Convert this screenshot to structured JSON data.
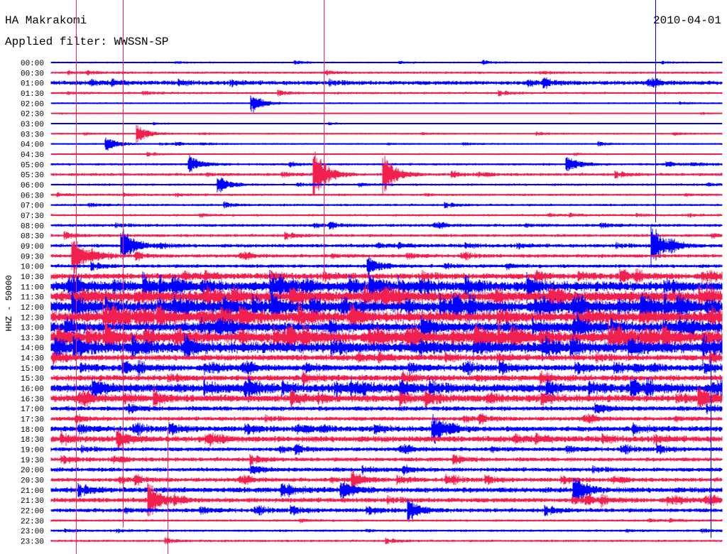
{
  "header": {
    "station": "HA Makrakomi",
    "filter": "Applied filter: WWSSN-SP",
    "date": "2010-04-01"
  },
  "chart_data": {
    "type": "line",
    "title": "HA Makrakomi",
    "subtitle": "Applied filter: WWSSN-SP",
    "ylabel": "HHZ - 50000",
    "xlabel": "",
    "minutes_per_line": 30,
    "colors": {
      "even": "#0000ff",
      "odd": "#f0204f"
    },
    "rows": [
      "00:00",
      "00:30",
      "01:00",
      "01:30",
      "02:00",
      "02:30",
      "03:00",
      "03:30",
      "04:00",
      "04:30",
      "05:00",
      "05:30",
      "06:00",
      "06:30",
      "07:00",
      "07:30",
      "08:00",
      "08:30",
      "09:00",
      "09:30",
      "10:00",
      "10:30",
      "11:00",
      "11:30",
      "12:00",
      "12:30",
      "13:00",
      "13:30",
      "14:00",
      "14:30",
      "15:00",
      "15:30",
      "16:00",
      "16:30",
      "17:00",
      "17:30",
      "18:00",
      "18:30",
      "19:00",
      "19:30",
      "20:00",
      "20:30",
      "21:00",
      "21:30",
      "22:00",
      "22:30",
      "23:00",
      "23:30"
    ],
    "noise_level": [
      0.15,
      0.2,
      0.35,
      0.2,
      0.15,
      0.1,
      0.1,
      0.15,
      0.15,
      0.15,
      0.2,
      0.25,
      0.2,
      0.2,
      0.2,
      0.2,
      0.25,
      0.25,
      0.3,
      0.3,
      0.3,
      0.5,
      0.8,
      0.9,
      0.9,
      0.9,
      0.8,
      0.9,
      0.9,
      0.5,
      0.5,
      0.5,
      0.7,
      0.6,
      0.4,
      0.35,
      0.45,
      0.5,
      0.35,
      0.35,
      0.35,
      0.35,
      0.45,
      0.4,
      0.35,
      0.2,
      0.2,
      0.2
    ],
    "events": [
      {
        "row": "09:30",
        "minute": 1.0,
        "amp": 2.5
      },
      {
        "row": "09:00",
        "minute": 3.2,
        "amp": 2.0
      },
      {
        "row": "05:30",
        "minute": 11.8,
        "amp": 3.0
      },
      {
        "row": "05:30",
        "minute": 14.9,
        "amp": 2.2
      },
      {
        "row": "09:00",
        "minute": 26.9,
        "amp": 2.4
      },
      {
        "row": "10:00",
        "minute": 14.2,
        "amp": 1.0
      },
      {
        "row": "02:00",
        "minute": 9.0,
        "amp": 1.0
      },
      {
        "row": "03:30",
        "minute": 3.9,
        "amp": 0.9
      },
      {
        "row": "04:00",
        "minute": 2.5,
        "amp": 0.8
      },
      {
        "row": "05:00",
        "minute": 6.2,
        "amp": 0.9
      },
      {
        "row": "05:00",
        "minute": 23.1,
        "amp": 0.9
      },
      {
        "row": "06:00",
        "minute": 7.5,
        "amp": 0.9
      },
      {
        "row": "21:30",
        "minute": 4.4,
        "amp": 2.0
      },
      {
        "row": "22:00",
        "minute": 16.0,
        "amp": 1.2
      },
      {
        "row": "21:00",
        "minute": 13.0,
        "amp": 1.0
      },
      {
        "row": "21:00",
        "minute": 23.4,
        "amp": 1.6
      },
      {
        "row": "18:00",
        "minute": 17.1,
        "amp": 1.0
      },
      {
        "row": "18:30",
        "minute": 3.0,
        "amp": 1.0
      },
      {
        "row": "20:30",
        "minute": 13.5,
        "amp": 0.9
      },
      {
        "row": "16:30",
        "minute": 29.0,
        "amp": 1.2
      }
    ],
    "saturated_spikes": [
      {
        "minute": 1.1,
        "from": "00:00",
        "to": "23:30",
        "color": "odd"
      },
      {
        "minute": 3.2,
        "from": "00:00",
        "to": "22:30",
        "color": "odd"
      },
      {
        "minute": 12.2,
        "from": "00:00",
        "to": "10:00",
        "color": "odd"
      },
      {
        "minute": 27.0,
        "from": "00:00",
        "to": "07:30",
        "color": "even"
      },
      {
        "minute": 5.2,
        "from": "19:00",
        "to": "23:30",
        "color": "odd"
      },
      {
        "minute": 29.5,
        "from": "15:30",
        "to": "23:00",
        "color": "even"
      }
    ]
  }
}
